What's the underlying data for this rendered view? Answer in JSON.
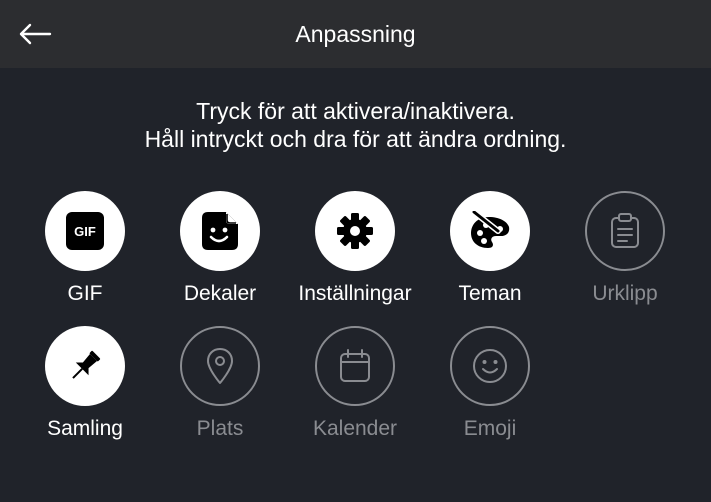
{
  "header": {
    "title": "Anpassning",
    "back_icon": "arrow-left-icon"
  },
  "instructions": {
    "line1": "Tryck för att aktivera/inaktivera.",
    "line2": "Håll intryckt och dra för att ändra ordning."
  },
  "colors": {
    "background": "#20232a",
    "header": "#2c2d30",
    "active": "#ffffff",
    "inactive": "#8a8c91"
  },
  "items": [
    {
      "label": "GIF",
      "icon": "gif-icon",
      "icon_text": "GIF",
      "enabled": true
    },
    {
      "label": "Dekaler",
      "icon": "sticker-icon",
      "enabled": true
    },
    {
      "label": "Inställningar",
      "icon": "gear-icon",
      "enabled": true
    },
    {
      "label": "Teman",
      "icon": "palette-icon",
      "enabled": true
    },
    {
      "label": "Urklipp",
      "icon": "clipboard-icon",
      "enabled": false
    },
    {
      "label": "Samling",
      "icon": "pin-icon",
      "enabled": true
    },
    {
      "label": "Plats",
      "icon": "location-pin-icon",
      "enabled": false
    },
    {
      "label": "Kalender",
      "icon": "calendar-icon",
      "enabled": false
    },
    {
      "label": "Emoji",
      "icon": "smiley-icon",
      "enabled": false
    }
  ]
}
